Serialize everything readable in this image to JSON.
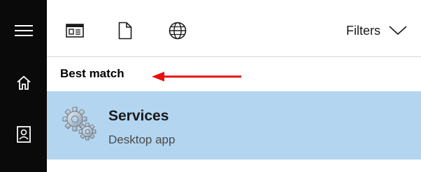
{
  "sidebar": {
    "items": [
      {
        "icon": "hamburger-menu-icon"
      },
      {
        "icon": "home-icon"
      },
      {
        "icon": "documents-icon"
      }
    ]
  },
  "toolbar": {
    "filters": [
      {
        "icon": "apps-icon"
      },
      {
        "icon": "document-icon"
      },
      {
        "icon": "globe-icon"
      }
    ],
    "filters_label": "Filters",
    "filters_icon": "chevron-down-icon"
  },
  "results": {
    "section_label": "Best match",
    "best_match": {
      "title": "Services",
      "subtitle": "Desktop app",
      "icon": "gears-icon"
    }
  },
  "annotation": {
    "arrow_color": "#e81010"
  }
}
